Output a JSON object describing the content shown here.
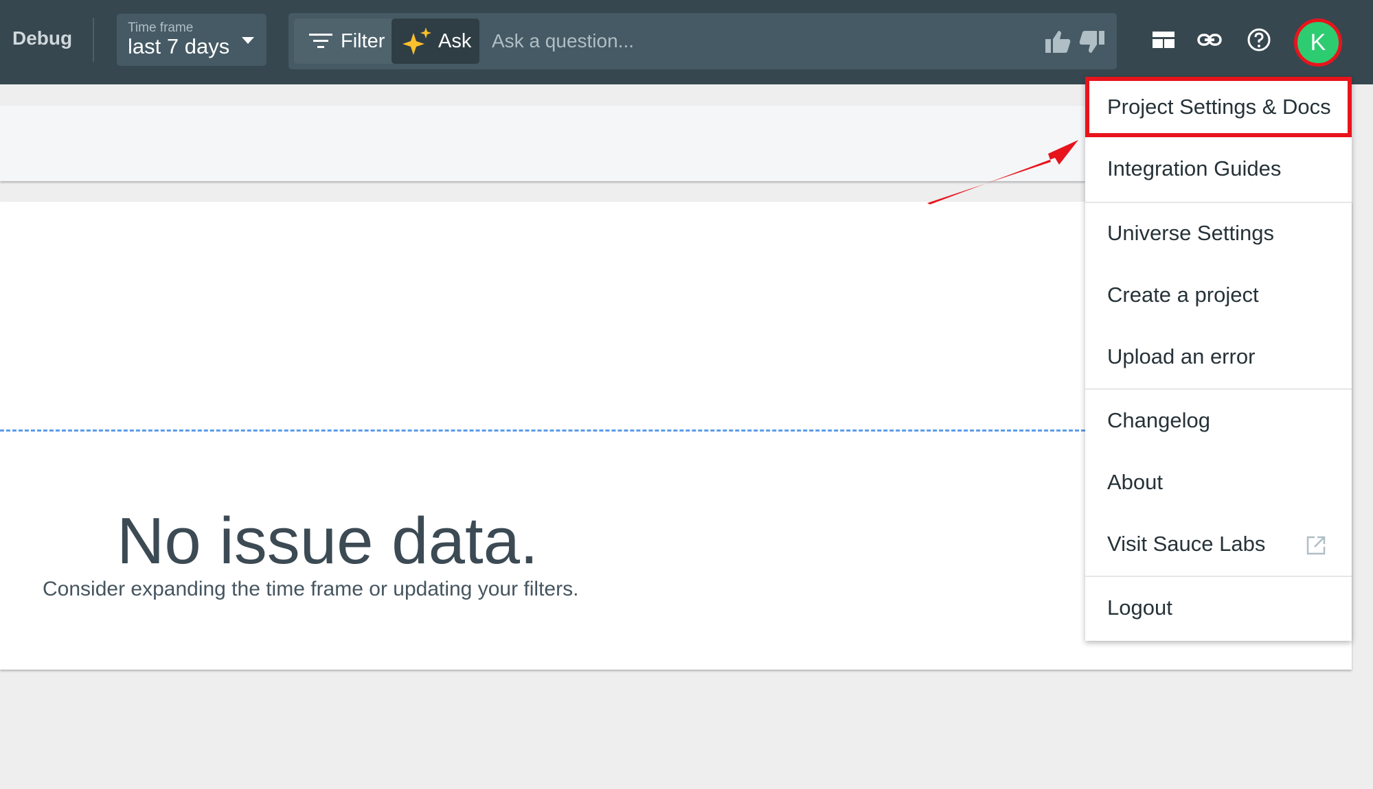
{
  "header": {
    "app_title": "Debug",
    "timeframe": {
      "label": "Time frame",
      "value": "last 7 days"
    },
    "query": {
      "filter_label": "Filter",
      "ask_label": "Ask",
      "placeholder": "Ask a question..."
    },
    "avatar_initial": "K"
  },
  "empty_state": {
    "title": "No issue data.",
    "subtitle": "Consider expanding the time frame or updating your filters."
  },
  "menu": {
    "items": [
      {
        "label": "Project Settings & Docs"
      },
      {
        "label": "Integration Guides"
      },
      {
        "label": "Universe Settings"
      },
      {
        "label": "Create a project"
      },
      {
        "label": "Upload an error"
      },
      {
        "label": "Changelog"
      },
      {
        "label": "About"
      },
      {
        "label": "Visit Sauce Labs"
      },
      {
        "label": "Logout"
      }
    ]
  },
  "icons": {
    "filter": "filter-icon",
    "ask": "sparkle-icon",
    "thumbs_up": "thumbs-up-icon",
    "thumbs_down": "thumbs-down-icon",
    "layout": "layout-icon",
    "link": "link-icon",
    "help": "help-icon",
    "external": "external-link-icon"
  },
  "colors": {
    "header_bg": "#37474f",
    "annotation_red": "#e8141c",
    "avatar_green": "#2ecc71",
    "dashed_line": "#5b9be9"
  }
}
